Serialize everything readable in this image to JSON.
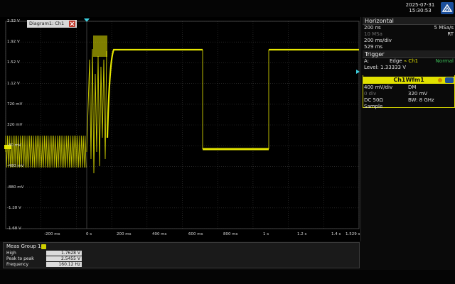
{
  "datetime": {
    "date": "2025-07-31",
    "time": "15:30:53"
  },
  "diagram": {
    "title": "Diagram1: Ch1",
    "y_labels": [
      "2.32 V",
      "1.92 V",
      "1.52 V",
      "1.12 V",
      "720 mV",
      "320 mV",
      "-80 mV",
      "-480 mV",
      "-880 mV",
      "-1.28 V",
      "-1.68 V"
    ],
    "x_labels": [
      "-200 ms",
      "0 s",
      "200 ms",
      "400 ms",
      "600 ms",
      "800 ms",
      "1 s",
      "1.2 s",
      "1.4 s",
      "1.529 s"
    ],
    "trace_color": "#e6e600"
  },
  "horizontal": {
    "title": "Horizontal",
    "rows": [
      {
        "left": "200 ns",
        "right": "5 MSa/s"
      },
      {
        "left": "10 MSa",
        "right": "RT"
      },
      {
        "left": "200 ms/div",
        "right": ""
      },
      {
        "left": "529 ms",
        "right": ""
      }
    ]
  },
  "trigger": {
    "title": "Trigger",
    "source": "A:",
    "type": "Edge",
    "channel": "Ch1",
    "mode": "Normal",
    "level": "Level: 1.33333 V"
  },
  "channel": {
    "title": "Ch1Wfm1",
    "rows": [
      {
        "left": "400 mV/div",
        "right": "DM"
      },
      {
        "left": "0 div",
        "right": "320 mV"
      },
      {
        "left": "DC 50Ω",
        "right": "BW: 8 GHz"
      },
      {
        "left": "Sample",
        "right": ""
      }
    ]
  },
  "measurement": {
    "title": "Meas Group 1",
    "rows": [
      {
        "label": "High",
        "value": "1.7628 V"
      },
      {
        "label": "Peak to peak",
        "value": "2.5455 V"
      },
      {
        "label": "Frequency",
        "value": "160.12 Hz"
      }
    ]
  }
}
